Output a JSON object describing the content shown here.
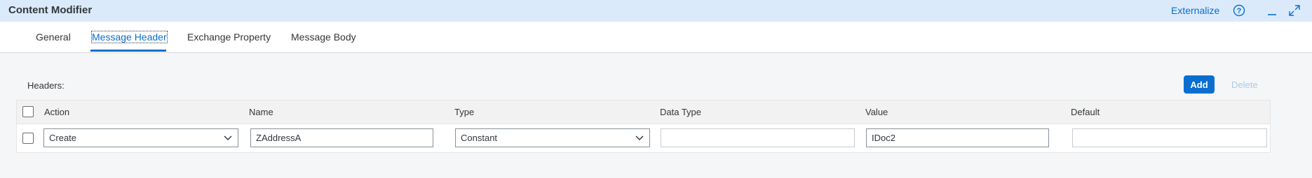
{
  "window": {
    "title": "Content Modifier",
    "externalize_label": "Externalize",
    "icons": [
      "help-icon",
      "minimize-icon",
      "expand-icon"
    ]
  },
  "tabs": [
    {
      "label": "General",
      "active": false
    },
    {
      "label": "Message Header",
      "active": true
    },
    {
      "label": "Exchange Property",
      "active": false
    },
    {
      "label": "Message Body",
      "active": false
    }
  ],
  "section": {
    "label": "Headers:",
    "add_label": "Add",
    "delete_label": "Delete"
  },
  "table": {
    "columns": [
      "Action",
      "Name",
      "Type",
      "Data Type",
      "Value",
      "Default"
    ],
    "rows": [
      {
        "action": "Create",
        "name": "ZAddressA",
        "type": "Constant",
        "data_type": "",
        "value": "IDoc2",
        "default": ""
      }
    ]
  },
  "colors": {
    "titlebar_bg": "#dbeafa",
    "accent": "#0a6ed1",
    "disabled_text": "#a9c9ea"
  }
}
